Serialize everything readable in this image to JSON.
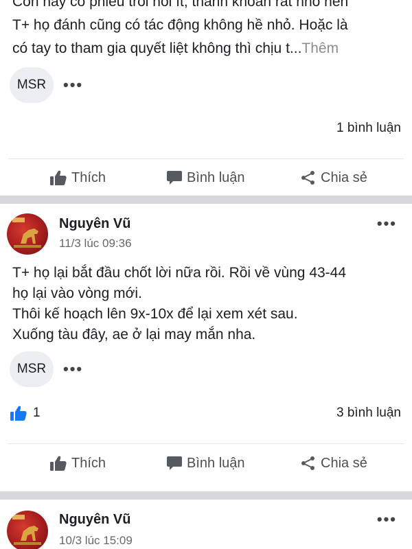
{
  "post1": {
    "text_lines": [
      "Còn này cổ phiếu trôi nổi ít, thanh khoản rất nhỏ nên",
      "T+ họ đánh cũng có tác động không hề nhỏ. Hoặc là",
      "có tay to tham gia quyết liệt không thì chịu t..."
    ],
    "more_label": "Thêm",
    "tag": "MSR",
    "comments": "1 bình luận"
  },
  "post2": {
    "author": "Nguyên Vũ",
    "time": "11/3 lúc 09:36",
    "text_lines": [
      "T+ họ lại bắt đầu chốt lời nữa rồi. Rồi về vùng 43-44",
      "họ lại vào vòng mới.",
      "Thôi kế hoạch lên 9x-10x để lại xem xét sau.",
      "Xuống tàu đây, ae ở lại may mắn nha."
    ],
    "tag": "MSR",
    "likes": "1",
    "comments": "3 bình luận"
  },
  "post3": {
    "author": "Nguyên Vũ",
    "time": "10/3 lúc 15:09"
  },
  "actions": {
    "like": "Thích",
    "comment": "Bình luận",
    "share": "Chia sẻ"
  },
  "icons": {
    "like": "thumbs-up-icon",
    "comment": "comment-bubble-icon",
    "share": "share-icon",
    "more": "more-dots-icon"
  },
  "colors": {
    "like_blue": "#1877f2",
    "separator": "#d6d8dc",
    "secondary_text": "#65676b"
  }
}
